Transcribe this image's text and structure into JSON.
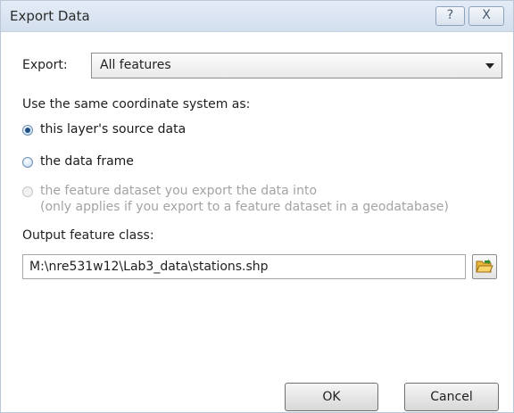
{
  "window": {
    "title": "Export Data",
    "help_icon": "question-mark-icon",
    "help_glyph": "?",
    "close_icon": "close-icon",
    "close_glyph": "X"
  },
  "export": {
    "label": "Export:",
    "selected": "All features"
  },
  "coordinate_system": {
    "heading": "Use the same coordinate system as:",
    "options": [
      {
        "label": "this layer's source data",
        "checked": true,
        "enabled": true
      },
      {
        "label": "the data frame",
        "checked": false,
        "enabled": true
      },
      {
        "label": "the feature dataset you export the data into",
        "label_line2": "(only applies if you export to a feature dataset in a geodatabase)",
        "checked": false,
        "enabled": false
      }
    ]
  },
  "output": {
    "label": "Output feature class:",
    "path": "M:\\nre531w12\\Lab3_data\\stations.shp",
    "browse_icon": "folder-open-icon"
  },
  "buttons": {
    "ok": "OK",
    "cancel": "Cancel"
  }
}
